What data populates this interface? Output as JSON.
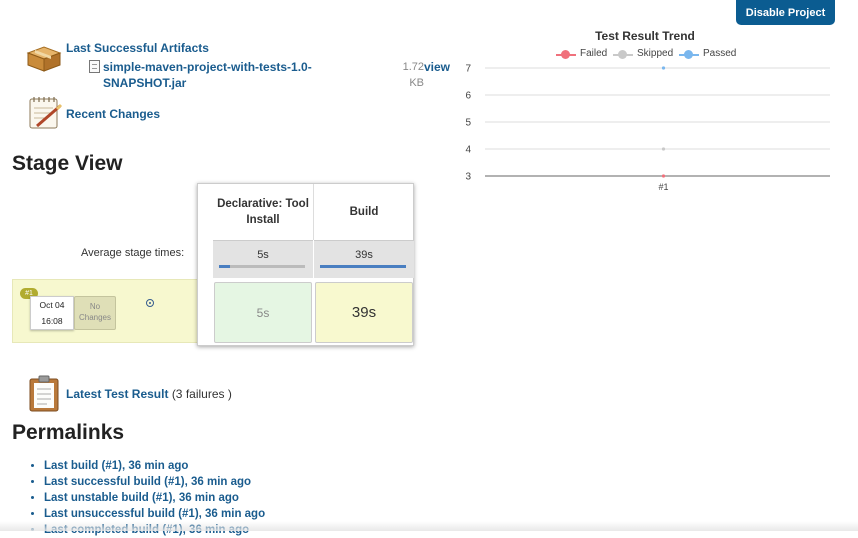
{
  "header": {
    "disable_button": "Disable Project"
  },
  "artifacts": {
    "title": "Last Successful Artifacts",
    "file_name": "simple-maven-project-with-tests-1.0-SNAPSHOT.jar",
    "file_size": "1.72 KB",
    "view_label": "view"
  },
  "recent_changes": "Recent Changes",
  "stage_view": {
    "title": "Stage View",
    "average_label": "Average stage times:",
    "stages": [
      {
        "name": "Declarative: Tool Install",
        "avg": "5s",
        "avg_fraction": 0.13
      },
      {
        "name": "Build",
        "avg": "39s",
        "avg_fraction": 1.0
      }
    ],
    "run": {
      "badge": "#1",
      "date": "Oct 04",
      "time": "16:08",
      "changes": "No Changes",
      "durations": [
        "5s",
        "39s"
      ]
    }
  },
  "trend": {
    "title": "Test Result Trend",
    "legend": [
      "Failed",
      "Skipped",
      "Passed"
    ],
    "colors": {
      "failed": "#f0717c",
      "skipped": "#c9c9c9",
      "passed": "#7ab7ee"
    }
  },
  "chart_data": {
    "type": "line",
    "title": "Test Result Trend",
    "categories": [
      "#1"
    ],
    "series": [
      {
        "name": "Failed",
        "values": [
          3
        ]
      },
      {
        "name": "Skipped",
        "values": [
          4
        ]
      },
      {
        "name": "Passed",
        "values": [
          7
        ]
      }
    ],
    "ylim": [
      3,
      7
    ],
    "yticks": [
      3,
      4,
      5,
      6,
      7
    ],
    "legend_position": "top",
    "grid": true
  },
  "latest_test": {
    "link": "Latest Test Result",
    "suffix": "(3 failures )"
  },
  "permalinks": {
    "title": "Permalinks",
    "items": [
      "Last build (#1), 36 min ago",
      "Last successful build (#1), 36 min ago",
      "Last unstable build (#1), 36 min ago",
      "Last unsuccessful build (#1), 36 min ago",
      "Last completed build (#1), 36 min ago"
    ]
  }
}
